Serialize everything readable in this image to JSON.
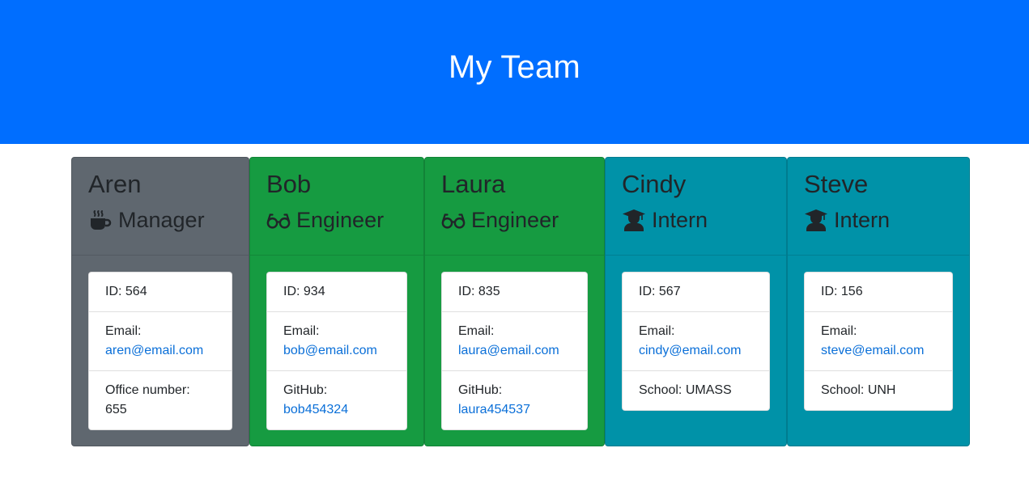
{
  "header": {
    "title": "My Team"
  },
  "team": [
    {
      "name": "Aren",
      "role": "Manager",
      "icon": "coffee-icon",
      "color": "#5f676f",
      "id_text": "ID: 564",
      "email_label": "Email:",
      "email": "aren@email.com",
      "extra_label": "Office number:",
      "extra_value": "655",
      "extra_is_link": false
    },
    {
      "name": "Bob",
      "role": "Engineer",
      "icon": "glasses-icon",
      "color": "#169b41",
      "id_text": "ID: 934",
      "email_label": "Email:",
      "email": "bob@email.com",
      "extra_label": "GitHub:",
      "extra_value": "bob454324",
      "extra_is_link": true
    },
    {
      "name": "Laura",
      "role": "Engineer",
      "icon": "glasses-icon",
      "color": "#169b41",
      "id_text": "ID: 835",
      "email_label": "Email:",
      "email": "laura@email.com",
      "extra_label": "GitHub:",
      "extra_value": "laura454537",
      "extra_is_link": true
    },
    {
      "name": "Cindy",
      "role": "Intern",
      "icon": "graduate-icon",
      "color": "#0092a8",
      "id_text": "ID: 567",
      "email_label": "Email:",
      "email": "cindy@email.com",
      "extra_text": "School: UMASS"
    },
    {
      "name": "Steve",
      "role": "Intern",
      "icon": "graduate-icon",
      "color": "#0092a8",
      "id_text": "ID: 156",
      "email_label": "Email:",
      "email": "steve@email.com",
      "extra_text": "School: UNH"
    }
  ]
}
